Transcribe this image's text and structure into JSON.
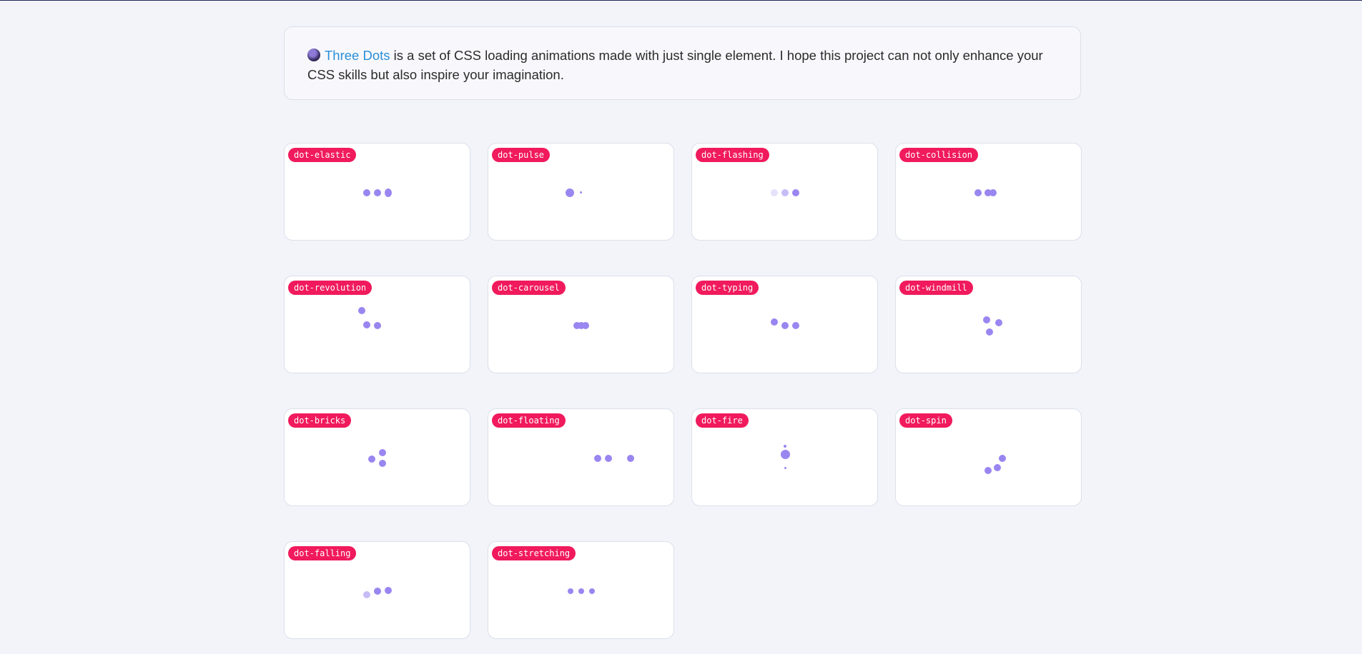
{
  "intro": {
    "emoji_icon": "crystal-ball-icon",
    "link_text": "Three Dots",
    "text": " is a set of CSS loading animations made with just single element. I hope this project can not only enhance your CSS skills but also inspire your imagination."
  },
  "colors": {
    "dot": "#9a86f0",
    "badge": "#f01a5c",
    "link": "#2b8fd6"
  },
  "cards": [
    {
      "label": "dot-elastic"
    },
    {
      "label": "dot-pulse"
    },
    {
      "label": "dot-flashing"
    },
    {
      "label": "dot-collision"
    },
    {
      "label": "dot-revolution"
    },
    {
      "label": "dot-carousel"
    },
    {
      "label": "dot-typing"
    },
    {
      "label": "dot-windmill"
    },
    {
      "label": "dot-bricks"
    },
    {
      "label": "dot-floating"
    },
    {
      "label": "dot-fire"
    },
    {
      "label": "dot-spin"
    },
    {
      "label": "dot-falling"
    },
    {
      "label": "dot-stretching"
    }
  ]
}
